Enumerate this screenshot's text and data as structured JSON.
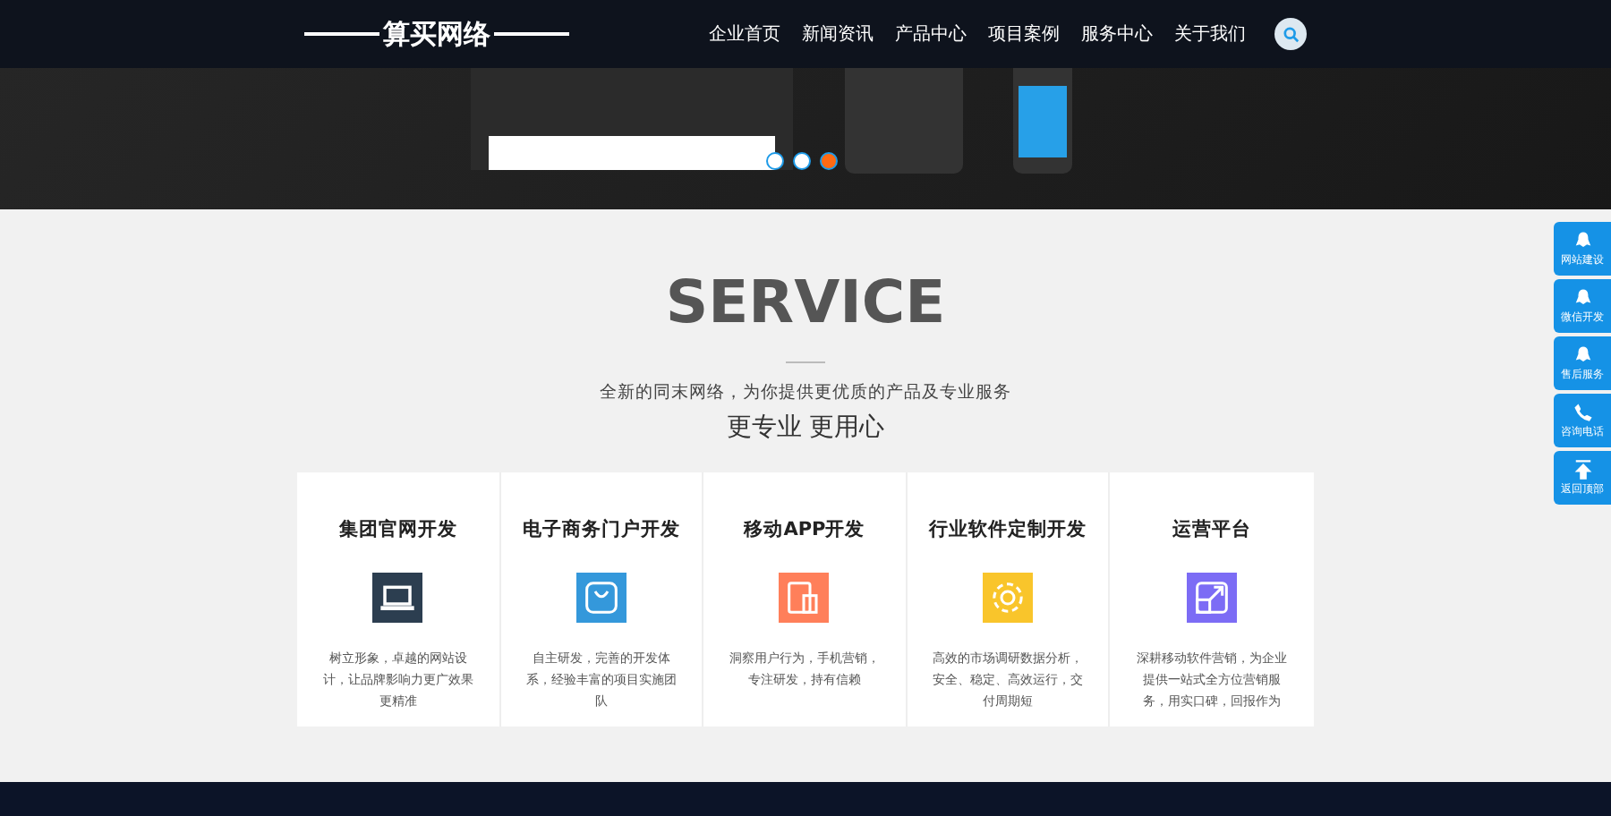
{
  "header": {
    "logo": "算买网络",
    "nav": [
      {
        "label": "企业首页",
        "selected": false
      },
      {
        "label": "新闻资讯",
        "selected": false
      },
      {
        "label": "产品中心",
        "selected": false
      },
      {
        "label": "项目案例",
        "selected": false
      },
      {
        "label": "服务中心",
        "selected": false
      },
      {
        "label": "关于我们",
        "selected": false
      }
    ]
  },
  "banner": {
    "dots": [
      {
        "selected": false
      },
      {
        "selected": false
      },
      {
        "selected": true
      }
    ]
  },
  "service": {
    "title": "SERVICE",
    "subtitle": "全新的同末网络，为你提供更优质的产品及专业服务",
    "slogan": "更专业 更用心",
    "cards": [
      {
        "title": "集团官网开发",
        "kind": "laptop",
        "color": "#2c3e50",
        "text": "树立形象，卓越的网站设计，让品牌影响力更广效果更精准"
      },
      {
        "title": "电子商务门户开发",
        "kind": "shop",
        "color": "#3498db",
        "text": "自主研发，完善的开发体系，经验丰富的项目实施团队"
      },
      {
        "title": "移动APP开发",
        "kind": "mobile",
        "color": "#ff7f5a",
        "text": "洞察用户行为，手机营销，专注研发，持有信赖"
      },
      {
        "title": "行业软件定制开发",
        "kind": "gear",
        "color": "#f9c52b",
        "text": "高效的市场调研数据分析，安全、稳定、高效运行，交付周期短"
      },
      {
        "title": "运营平台",
        "kind": "expand",
        "color": "#7c6cf5",
        "text": "深耕移动软件营销，为企业提供一站式全方位营销服务，用实口碑，回报作为"
      }
    ]
  },
  "side_bar": [
    {
      "label": "网站建设",
      "kind": "chat"
    },
    {
      "label": "微信开发",
      "kind": "chat"
    },
    {
      "label": "售后服务",
      "kind": "chat"
    },
    {
      "label": "咨询电话",
      "kind": "phone"
    },
    {
      "label": "返回顶部",
      "kind": "top"
    }
  ]
}
